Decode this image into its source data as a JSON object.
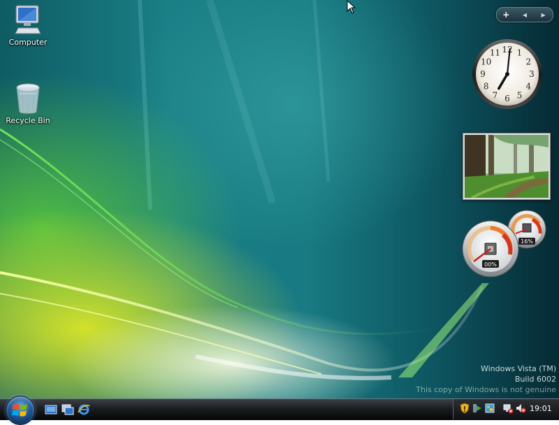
{
  "desktop": {
    "icons": [
      {
        "label": "Computer"
      },
      {
        "label": "Recycle Bin"
      }
    ]
  },
  "sidebar": {
    "controls": {
      "add_label": "+",
      "prev_label": "◂",
      "next_label": "▸"
    },
    "clock": {
      "hour": 7,
      "minute": 1,
      "numerals": [
        "12",
        "1",
        "2",
        "3",
        "4",
        "5",
        "6",
        "7",
        "8",
        "9",
        "10",
        "11"
      ]
    },
    "cpu_meter": {
      "cpu_percent_label": "00%",
      "memory_percent_label": "16%",
      "cpu_percent": 0,
      "memory_percent": 16
    }
  },
  "watermark": {
    "line1": "Windows Vista (TM)",
    "line2": "Build 6002",
    "line3": "This copy of Windows is not genuine"
  },
  "taskbar": {
    "quick_launch": [
      "show-desktop-icon",
      "switch-windows-icon",
      "internet-explorer-icon"
    ],
    "tray": {
      "time": "19:01"
    }
  },
  "colors": {
    "accent": "#1e5a9c",
    "wallpaper_teal": "#187a82",
    "wallpaper_green": "#5ac83c",
    "wallpaper_yellow": "#dce628"
  }
}
